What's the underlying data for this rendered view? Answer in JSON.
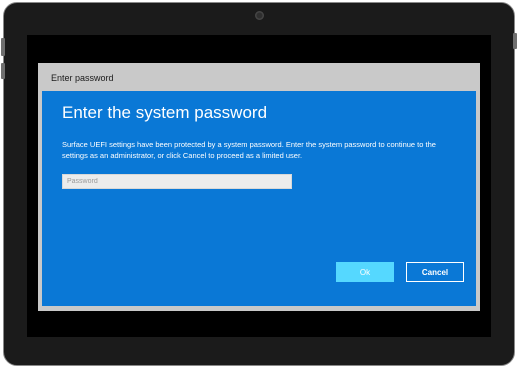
{
  "dialog": {
    "window_title": "Enter password",
    "heading": "Enter the system password",
    "description": "Surface UEFI settings have been protected by a system password. Enter the system password to continue to the settings as an administrator, or click Cancel to proceed as a limited user.",
    "password_field": {
      "placeholder": "Password",
      "value": ""
    },
    "ok_label": "Ok",
    "cancel_label": "Cancel"
  },
  "colors": {
    "dialog_blue": "#0a78d6",
    "ok_accent": "#55d8ff",
    "title_bar": "#c9c9c9",
    "bezel": "#1b1b1b"
  }
}
